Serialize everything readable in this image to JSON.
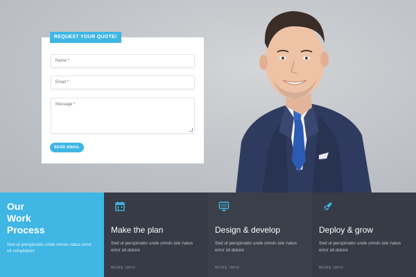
{
  "form": {
    "tag": "REQUEST YOUR QUOTE!",
    "name_placeholder": "Name *",
    "email_placeholder": "Email *",
    "message_placeholder": "Message *",
    "send_label": "SEND EMAIL"
  },
  "process": {
    "title": "Our\nWork\nProcess",
    "text": "Sed ut perspiciatis unde omnis natus error sit voluptatem",
    "steps": [
      {
        "icon": "calendar-icon",
        "title": "Make the plan",
        "text": "Sed ut perspiciatis unde omnis iste natus error sit dolore",
        "more": "MORE INFO"
      },
      {
        "icon": "monitor-icon",
        "title": "Design & develop",
        "text": "Sed ut perspiciatis unde omnis iste natus error sit dolore",
        "more": "MORE INFO"
      },
      {
        "icon": "rocket-icon",
        "title": "Deploy & grow",
        "text": "Sed ut perspiciatis unde omnis iste natus error sit dolore",
        "more": "MORE INFO"
      }
    ]
  },
  "colors": {
    "accent": "#3fb6e4",
    "dark_panel": "#363b45",
    "background": "#c3c6ca"
  }
}
